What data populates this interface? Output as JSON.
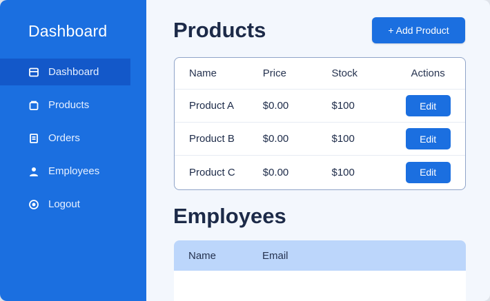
{
  "sidebar": {
    "brand": "Dashboard",
    "items": [
      {
        "label": "Dashboard",
        "icon": "dashboard-icon",
        "active": true
      },
      {
        "label": "Products",
        "icon": "box-icon",
        "active": false
      },
      {
        "label": "Orders",
        "icon": "document-icon",
        "active": false
      },
      {
        "label": "Employees",
        "icon": "user-icon",
        "active": false
      },
      {
        "label": "Logout",
        "icon": "logout-icon",
        "active": false
      }
    ]
  },
  "products": {
    "title": "Products",
    "add_label": "+ Add Product",
    "columns": [
      "Name",
      "Price",
      "Stock",
      "Actions"
    ],
    "rows": [
      {
        "name": "Product A",
        "price": "$0.00",
        "stock": "$100",
        "action": "Edit"
      },
      {
        "name": "Product B",
        "price": "$0.00",
        "stock": "$100",
        "action": "Edit"
      },
      {
        "name": "Product C",
        "price": "$0.00",
        "stock": "$100",
        "action": "Edit"
      }
    ]
  },
  "employees": {
    "title": "Employees",
    "columns": [
      "Name",
      "Email"
    ]
  },
  "colors": {
    "accent": "#1b6fe0",
    "sidebar_active": "#1358c9",
    "heading": "#1c2a48",
    "table_header": "#bcd6fb"
  }
}
